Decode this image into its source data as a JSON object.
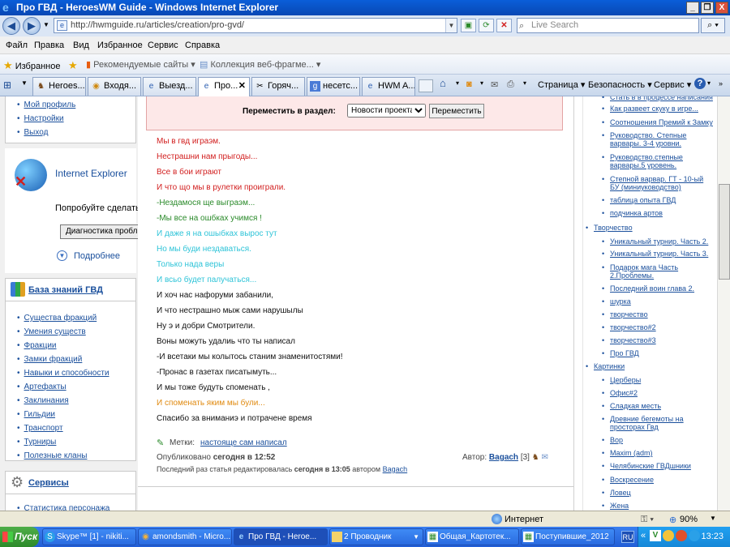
{
  "window": {
    "title": "Про ГВД - HeroesWM Guide - Windows Internet Explorer",
    "min": "_",
    "max": "❐",
    "close": "X"
  },
  "address": {
    "url": "http://hwmguide.ru/articles/creation/pro-gvd/",
    "search_placeholder": "Live Search"
  },
  "menu": [
    "Файл",
    "Правка",
    "Вид",
    "Избранное",
    "Сервис",
    "Справка"
  ],
  "favorites": {
    "label": "Избранное",
    "suggested": "Рекомендуемые сайты ▾",
    "gallery": "Коллекция веб-фрагме... ▾"
  },
  "tabs": [
    "Heroes...",
    "Входя...",
    "Выезд...",
    "Про...",
    "Горяч...",
    "несетс...",
    "HWM A..."
  ],
  "command_bar": {
    "page": "Страница ▾",
    "security": "Безопасность ▾",
    "tools": "Сервис ▾"
  },
  "left": {
    "account_links": [
      "Мой профиль",
      "Настройки",
      "Выход"
    ],
    "ie_promo": {
      "title": "Internet Explorer",
      "text": "Попробуйте сделать",
      "button": "Диагностика пробл",
      "more": "Подробнее"
    },
    "kb_title": "База знаний ГВД",
    "kb_links": [
      "Существа фракций",
      "Умения существ",
      "Фракции",
      "Замки фракций",
      "Навыки и способности",
      "Артефакты",
      "Заклинания",
      "Гильдии",
      "Транспорт",
      "Турниры",
      "Полезные кланы"
    ],
    "services_title": "Сервисы",
    "services_cut": "Статистика персонажа"
  },
  "article": {
    "move_label": "Переместить в раздел:",
    "move_select": "Новости проекта",
    "move_button": "Переместить",
    "lines": [
      {
        "text": "Мы в гвд играэм.",
        "color": "#d21f1f"
      },
      {
        "text": "Нестрашни нам прыгоды...",
        "color": "#d21f1f"
      },
      {
        "text": "Все в бои играют",
        "color": "#d21f1f"
      },
      {
        "text": "И что що мы в рулетки проиграли.",
        "color": "#d21f1f"
      },
      {
        "text": "-Нездамося ще выграэм...",
        "color": "#2a8a2a"
      },
      {
        "text": "-Мы все на ошбках учимся !",
        "color": "#2a8a2a"
      },
      {
        "text": "И даже я на ошыбках вырос тут",
        "color": "#2fc4d8"
      },
      {
        "text": "Но мы буди нездаваться.",
        "color": "#2fc4d8"
      },
      {
        "text": "Только нада веры",
        "color": "#2fc4d8"
      },
      {
        "text": "И всьо будет палучаться...",
        "color": "#2fc4d8"
      },
      {
        "text": "И хоч нас нафоруми забанили,",
        "color": "#111111"
      },
      {
        "text": "И что нестрашно мыж сами нарушылы",
        "color": "#111111"
      },
      {
        "text": "Ну э и добри Смотрители.",
        "color": "#111111"
      },
      {
        "text": "Воны можуть удалиь что ты написал",
        "color": "#111111"
      },
      {
        "text": "-И всетаки мы колытось станим знаменитостями!",
        "color": "#111111"
      },
      {
        "text": "-Пронас в газетах писатымуть...",
        "color": "#111111"
      },
      {
        "text": "И мы тоже будуть споменать ,",
        "color": "#111111"
      },
      {
        "text": "И споменать яким мы були...",
        "color": "#e08a10"
      },
      {
        "text": "Спасибо за вниманиэ и потрачене время",
        "color": "#111111"
      }
    ],
    "tags_label": "Метки:",
    "tags_value": "настояще сам написал",
    "published": "Опубликовано",
    "published_when": "сегодня в 12:52",
    "author_label": "Автор:",
    "author": "Bagach",
    "author_level": "[3]",
    "edited_text": "Последний раз статья редактировалась",
    "edited_when": "сегодня в 13:05",
    "edited_by": "автором",
    "editor": "Bagach"
  },
  "right": {
    "top_links": [
      "Стать в в процессе написания",
      "Как развеет скуку в игре...",
      "Соотношения Премий к Замку",
      "Руководство. Степные варвары. 3-4 уровни.",
      "Руководство.степные варвары.5 уровень.",
      "Степной варвар. ГТ - 10-ый БУ (миниуководство)",
      "таблица опыта ГВД",
      "подчинка артов"
    ],
    "creativity_title": "Творчество",
    "creativity_links": [
      "Уникальный турнир. Часть 2.",
      "Уникальный турнир. Часть 3.",
      "Подарок мага Часть 2.Проблемы.",
      "Последний воин глава 2.",
      "шурка",
      "творчество",
      "творчество#2",
      "творчество#3",
      "Про ГВД"
    ],
    "pictures_title": "Картинки",
    "pictures_links": [
      "Церберы",
      "Офис#2",
      "Сладкая месть",
      "Древние бегемоты на просторах Гвд",
      "Вор",
      "Maxim (adm)",
      "Челябинские ГВДшники",
      "Воскресение",
      "Ловец",
      "Жена"
    ]
  },
  "status": {
    "zone": "Интернет",
    "zoom": "90%"
  },
  "taskbar": {
    "start": "Пуск",
    "items": [
      "Skype™ [1] - nikiti...",
      "amondsmith - Micro...",
      "Про ГВД - Heroe...",
      "2 Проводник",
      "Общая_Картотек...",
      "Поступившие_2012"
    ],
    "lang": "RU",
    "clock": "13:23"
  }
}
